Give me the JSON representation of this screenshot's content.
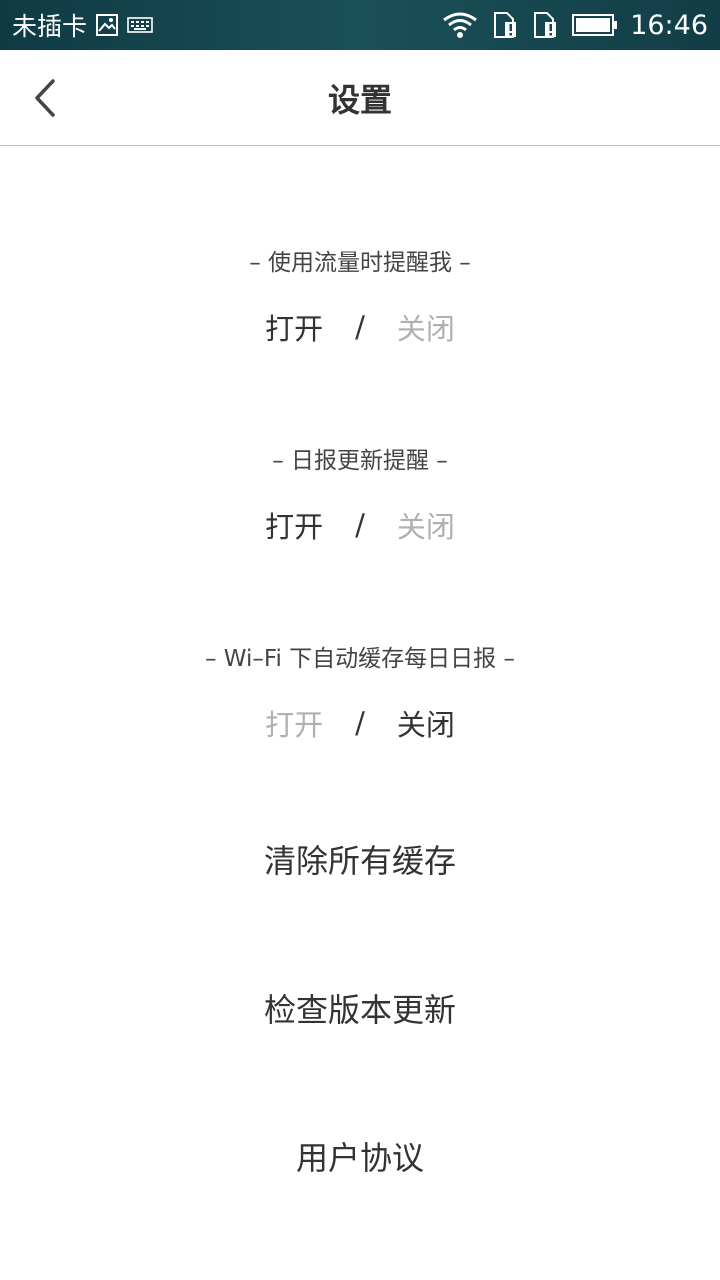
{
  "status_bar": {
    "carrier": "未插卡",
    "time": "16:46",
    "icons": [
      "image-icon",
      "keyboard-icon",
      "wifi-icon",
      "sim-alert-icon",
      "sim-alert-icon",
      "battery-icon"
    ]
  },
  "header": {
    "title": "设置",
    "back_icon": "chevron-left-icon"
  },
  "settings": {
    "data_usage": {
      "label": "– 使用流量时提醒我 –",
      "on": "打开",
      "separator": "/",
      "off": "关闭",
      "selected": "on"
    },
    "daily_update": {
      "label": "– 日报更新提醒 –",
      "on": "打开",
      "separator": "/",
      "off": "关闭",
      "selected": "on"
    },
    "wifi_cache": {
      "label": "– Wi–Fi 下自动缓存每日日报 –",
      "on": "打开",
      "separator": "/",
      "off": "关闭",
      "selected": "off"
    }
  },
  "actions": {
    "clear_cache": "清除所有缓存",
    "check_update": "检查版本更新",
    "user_agreement": "用户协议"
  },
  "colors": {
    "status_bar": "#15454f",
    "text_active": "#333333",
    "text_inactive": "#b0b0b0",
    "divider": "#bdbdbd"
  }
}
